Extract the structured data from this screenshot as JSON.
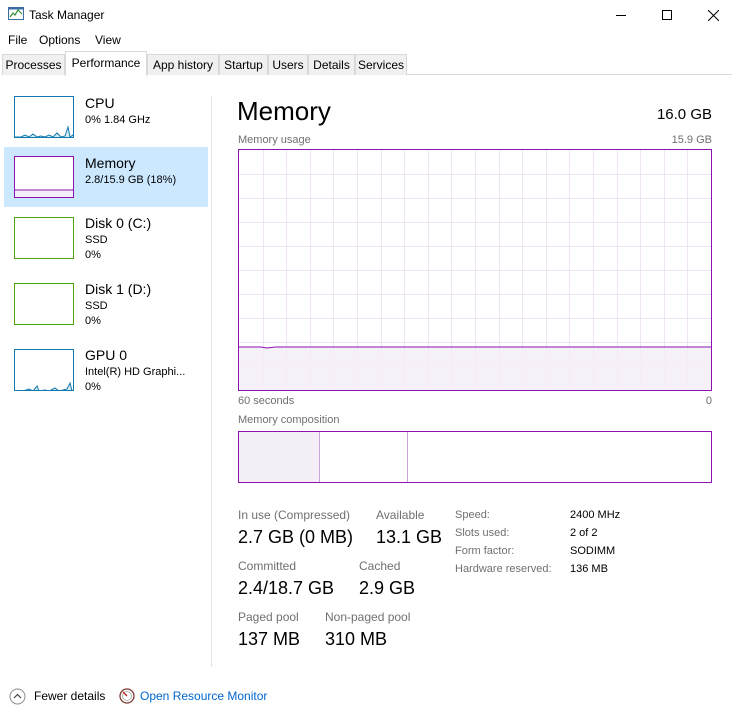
{
  "window": {
    "title": "Task Manager",
    "controls": {
      "minimize": "minimize",
      "maximize": "maximize",
      "close": "close"
    }
  },
  "menu": [
    "File",
    "Options",
    "View"
  ],
  "tabs": [
    {
      "label": "Processes"
    },
    {
      "label": "Performance",
      "active": true
    },
    {
      "label": "App history"
    },
    {
      "label": "Startup"
    },
    {
      "label": "Users"
    },
    {
      "label": "Details"
    },
    {
      "label": "Services"
    }
  ],
  "sidebar": {
    "items": [
      {
        "title": "CPU",
        "sub1": "0%  1.84 GHz",
        "sub2": "",
        "sub3": "",
        "color": "#1179ae"
      },
      {
        "title": "Memory",
        "sub1": "2.8/15.9 GB (18%)",
        "sub2": "",
        "sub3": "",
        "color": "#8b12ae",
        "selected": true
      },
      {
        "title": "Disk 0 (C:)",
        "sub1": "SSD",
        "sub2": "0%",
        "sub3": "",
        "color": "#4da60c"
      },
      {
        "title": "Disk 1 (D:)",
        "sub1": "SSD",
        "sub2": "0%",
        "sub3": "",
        "color": "#4da60c"
      },
      {
        "title": "GPU 0",
        "sub1": "Intel(R) HD Graphi...",
        "sub2": "0%",
        "sub3": "",
        "color": "#1179ae"
      }
    ]
  },
  "main": {
    "title": "Memory",
    "total": "16.0 GB",
    "usage_label": "Memory usage",
    "usage_max": "15.9 GB",
    "axis_left": "60 seconds",
    "axis_right": "0",
    "composition_label": "Memory composition",
    "graph_usage_fraction": 0.18,
    "composition": {
      "in_use_fraction": 0.17,
      "modified_fraction": 0.006,
      "standby_fraction": 0.18
    }
  },
  "stats": {
    "in_use": {
      "label": "In use (Compressed)",
      "value": "2.7 GB (0 MB)"
    },
    "available": {
      "label": "Available",
      "value": "13.1 GB"
    },
    "committed": {
      "label": "Committed",
      "value": "2.4/18.7 GB"
    },
    "cached": {
      "label": "Cached",
      "value": "2.9 GB"
    },
    "paged_pool": {
      "label": "Paged pool",
      "value": "137 MB"
    },
    "non_paged_pool": {
      "label": "Non-paged pool",
      "value": "310 MB"
    }
  },
  "details": [
    {
      "label": "Speed:",
      "value": "2400 MHz"
    },
    {
      "label": "Slots used:",
      "value": "2 of 2"
    },
    {
      "label": "Form factor:",
      "value": "SODIMM"
    },
    {
      "label": "Hardware reserved:",
      "value": "136 MB"
    }
  ],
  "footer": {
    "fewer_details": "Fewer details",
    "open_resource_monitor": "Open Resource Monitor"
  },
  "colors": {
    "memory": "#8b12ae",
    "cpu": "#1179ae",
    "disk": "#4da60c",
    "link": "#0066cc",
    "selected_bg": "#cce8ff"
  }
}
